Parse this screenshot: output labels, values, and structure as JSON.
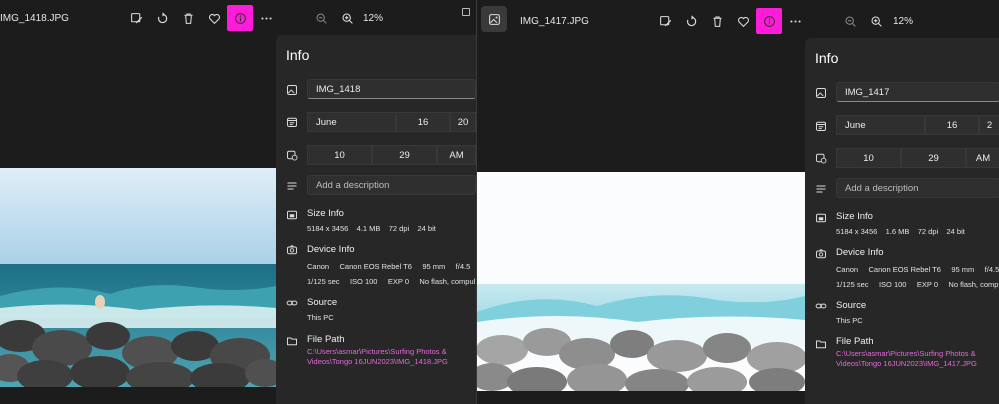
{
  "left": {
    "filename": "IMG_1418.JPG",
    "zoom": "12%",
    "info": {
      "title": "Info",
      "name_value": "IMG_1418",
      "date": {
        "month": "June",
        "day": "16",
        "year": "20"
      },
      "time": {
        "hour": "10",
        "minute": "29",
        "ampm": "AM"
      },
      "description_placeholder": "Add a description",
      "size_title": "Size Info",
      "size_line": "5184 x 3456    4.1 MB    72 dpi    24 bit",
      "device_title": "Device Info",
      "device_line1": "Canon     Canon EOS Rebel T6     95 mm     f/4.5",
      "device_line2": "1/125 sec     ISO 100     EXP 0     No flash, compul",
      "source_title": "Source",
      "source_value": "This PC",
      "path_title": "File Path",
      "path_value": "C:\\Users\\asmar\\Pictures\\Surfing Photos & Videos\\Tongo 16JUN2023\\IMG_1418.JPG"
    }
  },
  "right": {
    "filename": "IMG_1417.JPG",
    "zoom": "12%",
    "info": {
      "title": "Info",
      "name_value": "IMG_1417",
      "date": {
        "month": "June",
        "day": "16",
        "year": "2"
      },
      "time": {
        "hour": "10",
        "minute": "29",
        "ampm": "AM"
      },
      "description_placeholder": "Add a description",
      "size_title": "Size Info",
      "size_line": "5184 x 3456    1.6 MB    72 dpi    24 bit",
      "device_title": "Device Info",
      "device_line1": "Canon     Canon EOS Rebel T6     95 mm     f/4.5",
      "device_line2": "1/125 sec     ISO 100     EXP 0     No flash, comp",
      "source_title": "Source",
      "source_value": "This PC",
      "path_title": "File Path",
      "path_value": "C:\\Users\\asmar\\Pictures\\Surfing Photos & Videos\\Tongo 16JUN2023\\IMG_1417.JPG"
    }
  },
  "icons": [
    "edit-image-icon",
    "rotate-icon",
    "delete-icon",
    "favorite-icon",
    "info-icon",
    "more-icon",
    "zoom-out-icon",
    "zoom-in-icon",
    "gallery-icon"
  ],
  "colors": {
    "accent": "#ff1cd8",
    "link": "#e966e0",
    "panel": "#272727"
  }
}
